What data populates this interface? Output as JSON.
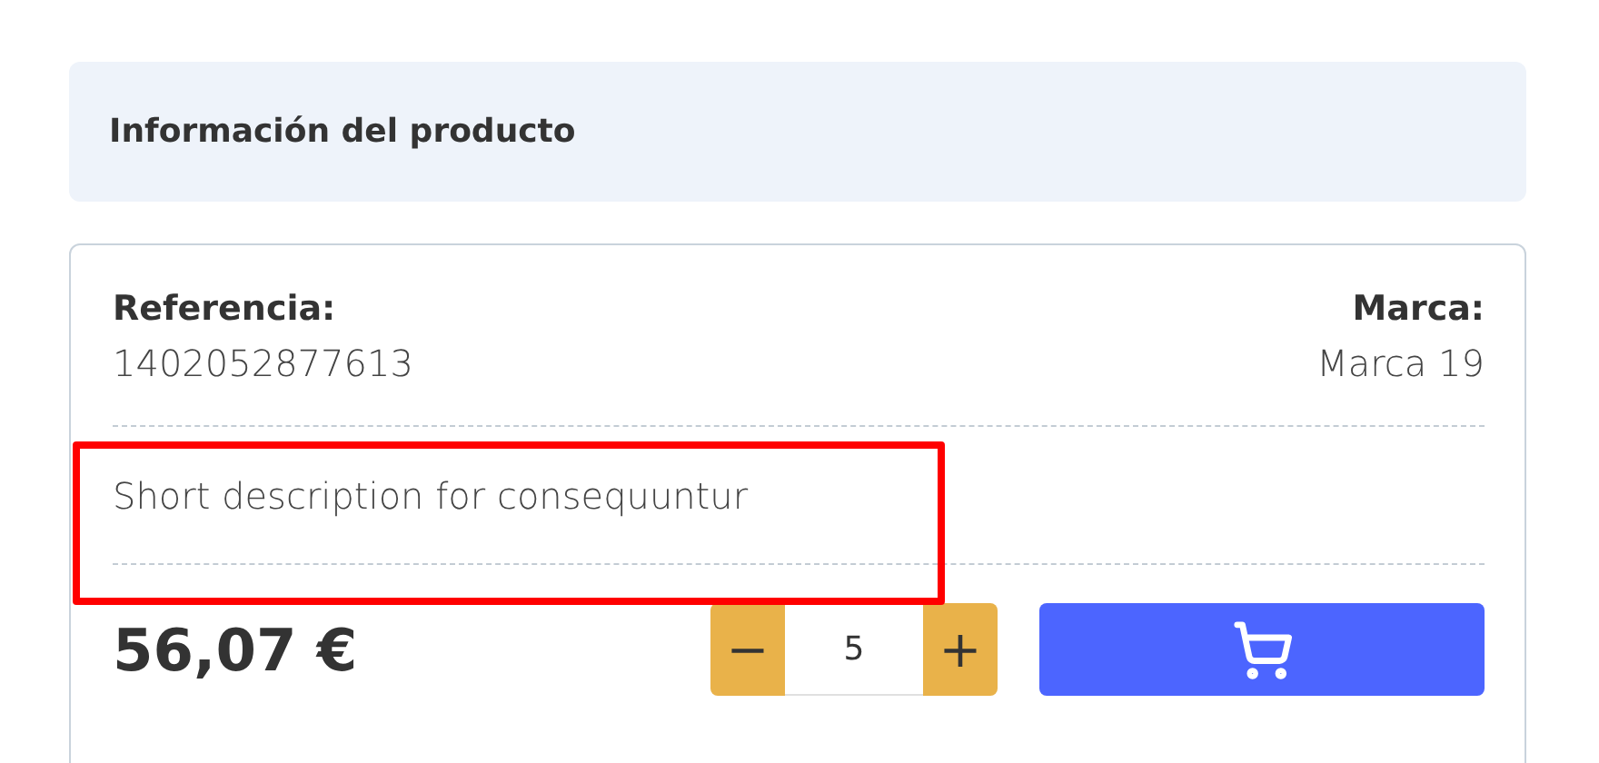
{
  "section_title": "Información del producto",
  "reference": {
    "label": "Referencia:",
    "value": "1402052877613"
  },
  "brand": {
    "label": "Marca:",
    "value": "Marca 19"
  },
  "description": {
    "text": "Short description for consequuntur",
    "highlighted": true
  },
  "price": "56,07 €",
  "quantity": {
    "minus": "−",
    "value": "5",
    "plus": "+"
  }
}
